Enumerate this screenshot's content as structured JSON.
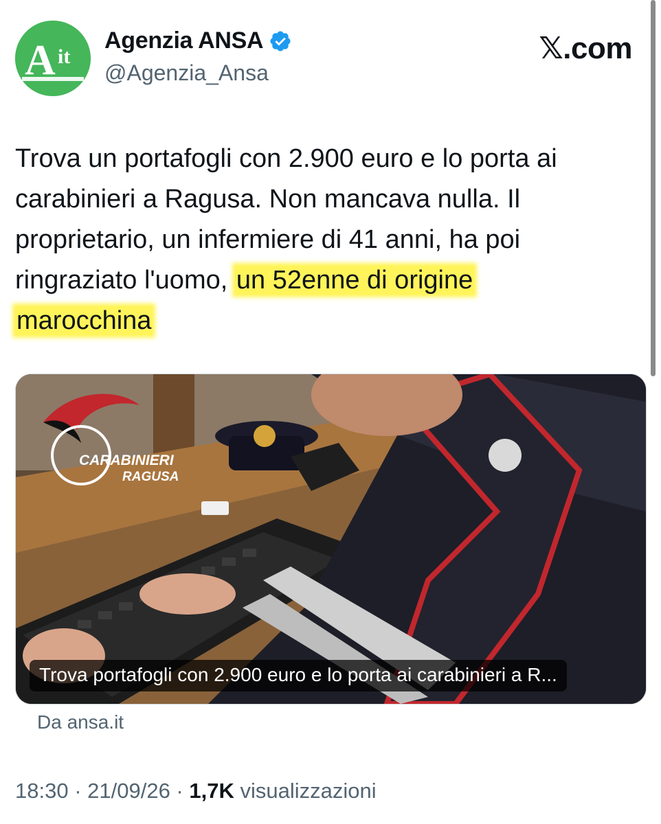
{
  "author": {
    "display_name": "Agenzia ANSA",
    "handle": "@Agenzia_Ansa",
    "avatar_text_main": "A",
    "avatar_text_sub": "it",
    "verified": true
  },
  "brand": "𝕏.com",
  "tweet": {
    "lines": [
      "Trova un portafogli con 2.900 euro e lo porta ai",
      "carabinieri a Ragusa. Non mancava nulla. Il",
      "proprietario, un infermiere di 41 anni, ha poi"
    ],
    "line4_plain": "ringraziato l'uomo, ",
    "line4_highlight": "un 52enne di origine",
    "line5_highlight": "marocchina"
  },
  "card": {
    "caption": "Trova portafogli con 2.900 euro e lo porta ai carabinieri a R...",
    "logo_line1": "CARABINIERI",
    "logo_line2": "RAGUSA",
    "source": "Da ansa.it"
  },
  "meta": {
    "time": "18:30",
    "sep1": " · ",
    "date": "21/09/26",
    "sep2": " · ",
    "views_count": "1,7K",
    "views_label": " visualizzazioni"
  },
  "colors": {
    "highlight": "#fff45a",
    "avatar_green": "#45b65a",
    "verified_blue": "#1d9bf0",
    "secondary_text": "#536471"
  }
}
